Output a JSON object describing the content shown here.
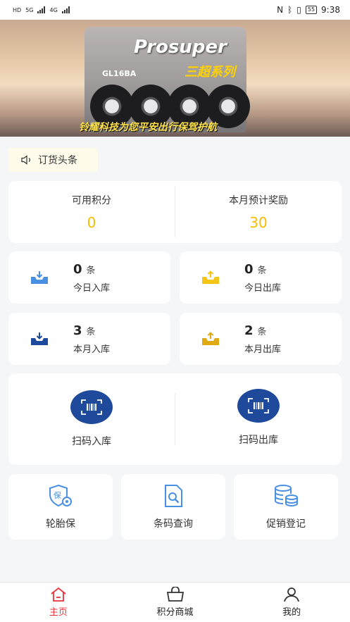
{
  "status_bar": {
    "left_labels": [
      "HD",
      "5G",
      "4G"
    ],
    "time": "9:38",
    "battery": "55"
  },
  "banner": {
    "brand": "Prosuper",
    "series": "三超系列",
    "model": "GL16BA",
    "slogan": "铃耀科技为您平安出行保驾护航"
  },
  "notice": {
    "label": "订货头条",
    "icon": "speaker-icon"
  },
  "points": {
    "available_label": "可用积分",
    "available_value": "0",
    "reward_label": "本月预计奖励",
    "reward_value": "30"
  },
  "stats": {
    "today_in": {
      "num": "0",
      "unit": "条",
      "label": "今日入库"
    },
    "today_out": {
      "num": "0",
      "unit": "条",
      "label": "今日出库"
    },
    "month_in": {
      "num": "3",
      "unit": "条",
      "label": "本月入库"
    },
    "month_out": {
      "num": "2",
      "unit": "条",
      "label": "本月出库"
    }
  },
  "scan": {
    "scan_in_label": "扫码入库",
    "scan_out_label": "扫码出库"
  },
  "tools": {
    "tire_insurance": "轮胎保",
    "barcode_query": "条码查询",
    "promo_register": "促销登记"
  },
  "tabs": {
    "home": "主页",
    "mall": "积分商城",
    "mine": "我的"
  },
  "colors": {
    "accent_blue": "#1f4a9b",
    "accent_yellow": "#f5bd00",
    "tab_active": "#e8333a",
    "icon_light_blue": "#4a90e2"
  }
}
